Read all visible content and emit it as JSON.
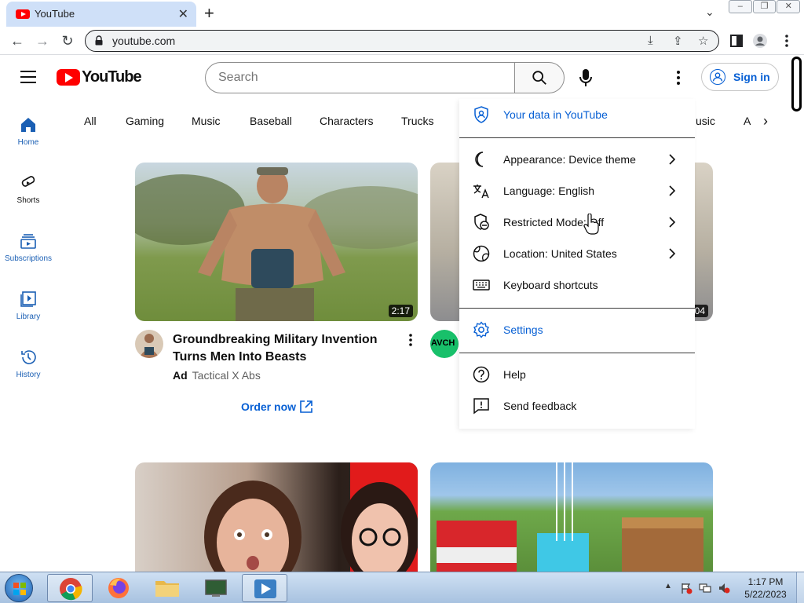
{
  "browser": {
    "tab_title": "YouTube",
    "url": "youtube.com"
  },
  "header": {
    "logo_text": "YouTube",
    "search_placeholder": "Search",
    "sign_in": "Sign in"
  },
  "guide": {
    "items": [
      {
        "label": "Home",
        "icon": "home-icon"
      },
      {
        "label": "Shorts",
        "icon": "shorts-icon"
      },
      {
        "label": "Subscriptions",
        "icon": "subscriptions-icon"
      },
      {
        "label": "Library",
        "icon": "library-icon"
      },
      {
        "label": "History",
        "icon": "history-icon"
      }
    ]
  },
  "chips": [
    "All",
    "Gaming",
    "Music",
    "Baseball",
    "Characters",
    "Trucks",
    "usic",
    "A"
  ],
  "videos": [
    {
      "title": "Groundbreaking Military Invention Turns Men Into Beasts",
      "ad_badge": "Ad",
      "channel": "Tactical X Abs",
      "duration": "2:17",
      "cta": "Order now"
    },
    {
      "duration": "04",
      "channel_avatar_text": "AVCH"
    }
  ],
  "menu": {
    "items": [
      {
        "label": "Your data in YouTube",
        "icon": "shield-person-icon"
      },
      {
        "label": "Appearance: Device theme",
        "icon": "moon-icon"
      },
      {
        "label": "Language: English",
        "icon": "translate-icon"
      },
      {
        "label": "Restricted Mode: Off",
        "icon": "restricted-icon"
      },
      {
        "label": "Location: United States",
        "icon": "globe-icon"
      },
      {
        "label": "Keyboard shortcuts",
        "icon": "keyboard-icon"
      },
      {
        "label": "Settings",
        "icon": "gear-icon"
      },
      {
        "label": "Help",
        "icon": "help-icon"
      },
      {
        "label": "Send feedback",
        "icon": "feedback-icon"
      }
    ]
  },
  "taskbar": {
    "time": "1:17 PM",
    "date": "5/22/2023"
  },
  "colors": {
    "accent_blue": "#065fd4",
    "youtube_red": "#ff0000",
    "tab_active": "#cfe0f8"
  }
}
